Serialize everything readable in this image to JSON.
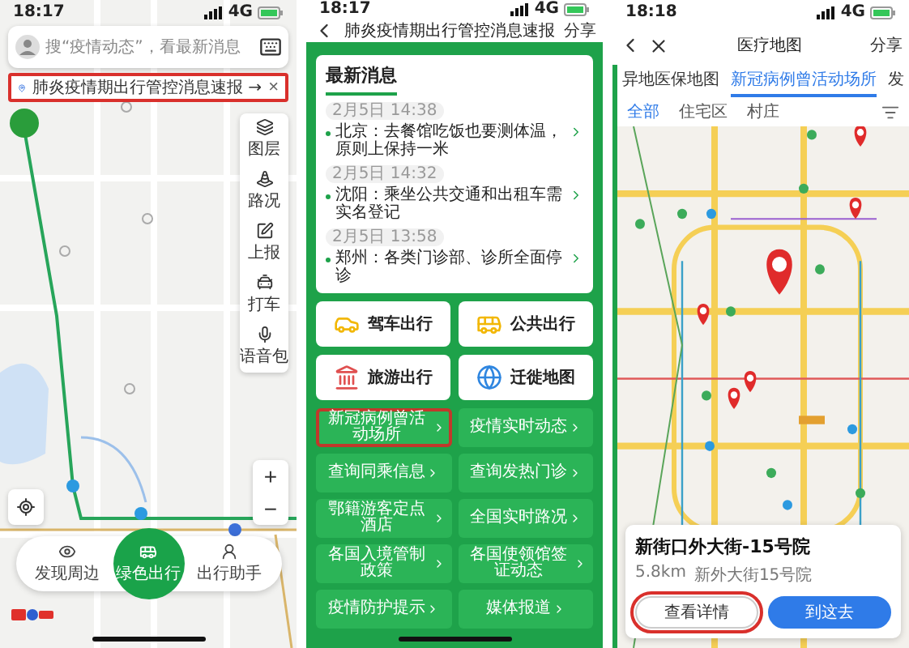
{
  "screens": [
    {
      "kind": "map_home",
      "status_bar": {
        "time": "18:17",
        "network": "4G"
      },
      "search": {
        "placeholder": "搜“疫情动态”，看最新消息"
      },
      "banner": {
        "text": "肺炎疫情期出行管控消息速报 →",
        "close": "×",
        "highlighted": true
      },
      "side_tools": [
        "图层",
        "路况",
        "上报",
        "打车",
        "语音包"
      ],
      "zoom": [
        "+",
        "−"
      ],
      "bottom_nav": [
        {
          "label": "发现周边",
          "selected": false
        },
        {
          "label": "绿色出行",
          "selected": true
        },
        {
          "label": "出行助手",
          "selected": false
        }
      ]
    },
    {
      "kind": "news",
      "status_bar": {
        "time": "18:17",
        "network": "4G"
      },
      "title": "肺炎疫情期出行管控消息速报",
      "share": "分享",
      "news_title": "最新消息",
      "news": [
        {
          "date": "2月5日 14:38",
          "text": "北京：去餐馆吃饭也要测体温，原则上保持一米"
        },
        {
          "date": "2月5日 14:32",
          "text": "沈阳：乘坐公共交通和出租车需实名登记"
        },
        {
          "date": "2月5日 13:58",
          "text": "郑州：各类门诊部、诊所全面停诊"
        }
      ],
      "tiles": [
        {
          "kind": "car",
          "label": "驾车出行"
        },
        {
          "kind": "bus",
          "label": "公共出行"
        },
        {
          "kind": "tour",
          "label": "旅游出行"
        },
        {
          "kind": "globe",
          "label": "迁徙地图"
        }
      ],
      "links": [
        {
          "label": "新冠病例曾活动场所",
          "highlighted": true
        },
        {
          "label": "疫情实时动态",
          "highlighted": false
        },
        {
          "label": "查询同乘信息",
          "highlighted": false
        },
        {
          "label": "查询发热门诊",
          "highlighted": false
        },
        {
          "label": "鄂籍游客定点酒店",
          "highlighted": false
        },
        {
          "label": "全国实时路况",
          "highlighted": false
        },
        {
          "label": "各国入境管制政策",
          "highlighted": false
        },
        {
          "label": "各国使领馆签证动态",
          "highlighted": false
        },
        {
          "label": "疫情防护提示",
          "highlighted": false
        },
        {
          "label": "媒体报道",
          "highlighted": false
        }
      ]
    },
    {
      "kind": "medical_map",
      "status_bar": {
        "time": "18:18",
        "network": "4G"
      },
      "title": "医疗地图",
      "share": "分享",
      "tabs": [
        {
          "label": "异地医保地图",
          "selected": false
        },
        {
          "label": "新冠病例曾活动场所",
          "selected": true
        },
        {
          "label": "发",
          "selected": false
        }
      ],
      "filters": [
        {
          "label": "全部",
          "selected": true
        },
        {
          "label": "住宅区",
          "selected": false
        },
        {
          "label": "村庄",
          "selected": false
        }
      ],
      "place": {
        "name": "新街口外大街-15号院",
        "distance": "5.8km",
        "address": "新外大街15号院"
      },
      "actions": [
        {
          "kind": "secondary",
          "label": "查看详情",
          "highlighted": true
        },
        {
          "kind": "primary",
          "label": "到这去",
          "highlighted": false
        }
      ]
    }
  ]
}
